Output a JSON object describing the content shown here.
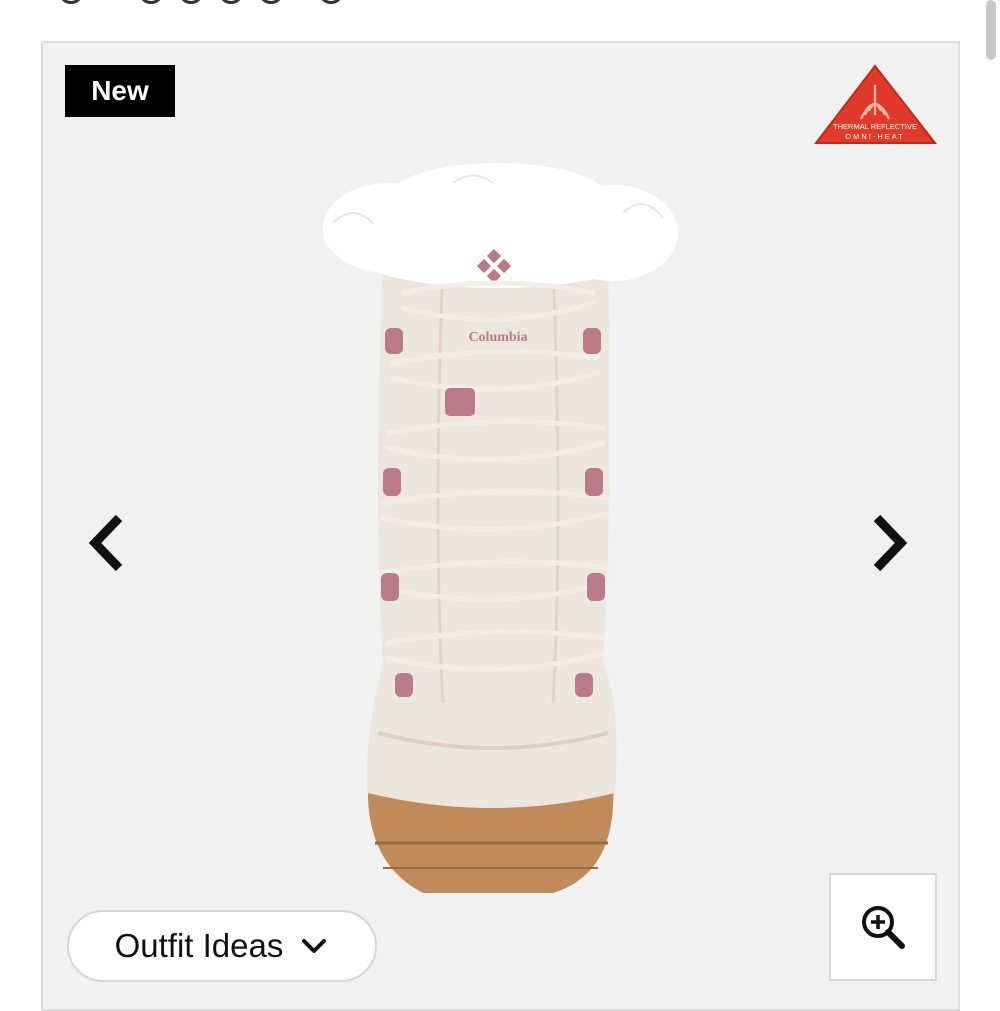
{
  "badge": {
    "label": "New"
  },
  "certification": {
    "line1": "THERMAL REFLECTIVE",
    "line2": "OMNI-HEAT",
    "color": "#e23a2a"
  },
  "product": {
    "brand_text": "Columbia"
  },
  "outfit_button": {
    "label": "Outfit Ideas"
  },
  "icons": {
    "prev": "chevron-left-icon",
    "next": "chevron-right-icon",
    "zoom": "zoom-in-icon",
    "dropdown": "chevron-down-icon"
  },
  "colors": {
    "gallery_bg": "#f1f1f1",
    "boot_body": "#ece7dd",
    "boot_fur": "#ffffff",
    "boot_accent": "#b97a8a",
    "boot_sole": "#c08a5a"
  }
}
